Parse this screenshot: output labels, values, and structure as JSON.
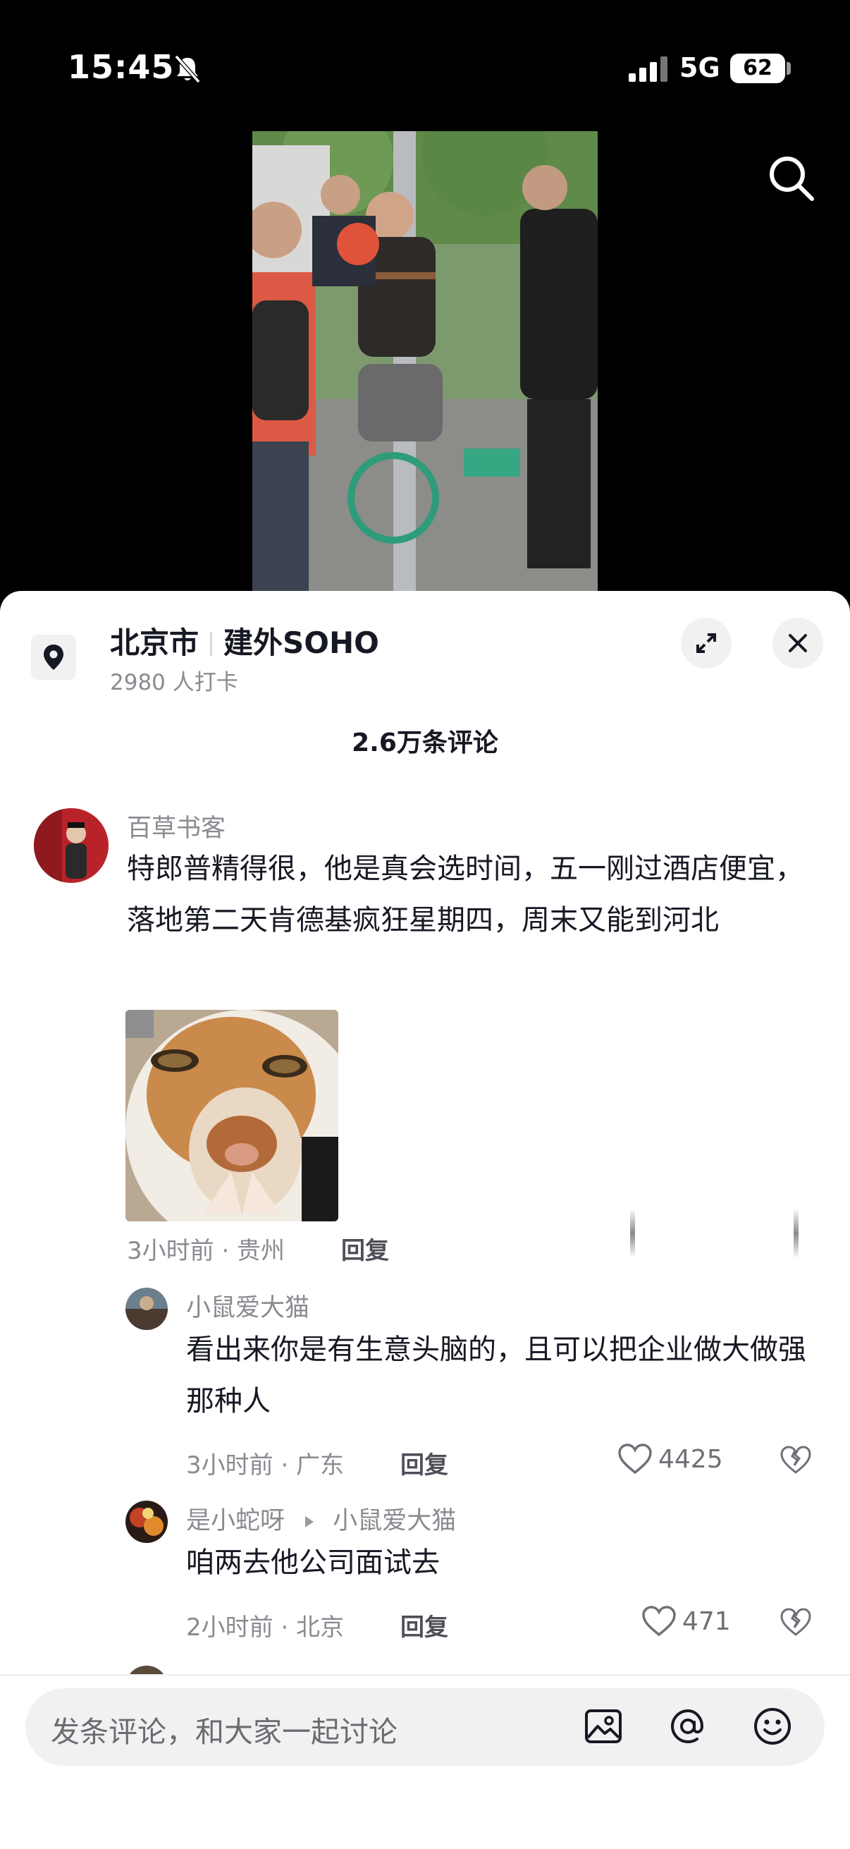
{
  "status": {
    "time": "15:45",
    "network": "5G",
    "battery": "62"
  },
  "location": {
    "city": "北京市",
    "place": "建外SOHO",
    "checkins": "2980 人打卡"
  },
  "comments_header": "2.6万条评论",
  "comments": [
    {
      "user": "百草书客",
      "text": "特郎普精得很，他是真会选时间，五一刚过酒店便宜，落地第二天肯德基疯狂星期四，周末又能到河北",
      "meta": "3小时前 · 贵州",
      "reply_label": "回复"
    }
  ],
  "replies": [
    {
      "user": "小鼠爱大猫",
      "text": "看出来你是有生意头脑的，且可以把企业做大做强那种人",
      "meta": "3小时前 · 广东",
      "reply_label": "回复",
      "likes": "4425"
    },
    {
      "user": "是小蛇呀",
      "reply_to": "小鼠爱大猫",
      "text": "咱两去他公司面试去",
      "meta": "2小时前 · 北京",
      "reply_label": "回复",
      "likes": "471"
    }
  ],
  "input": {
    "placeholder": "发条评论，和大家一起讨论"
  },
  "icons": [
    "bell-mute-icon",
    "signal-icon",
    "search-icon",
    "location-pin-icon",
    "expand-icon",
    "close-icon",
    "heart-icon",
    "dislike-icon",
    "image-icon",
    "at-icon",
    "emoji-icon"
  ]
}
